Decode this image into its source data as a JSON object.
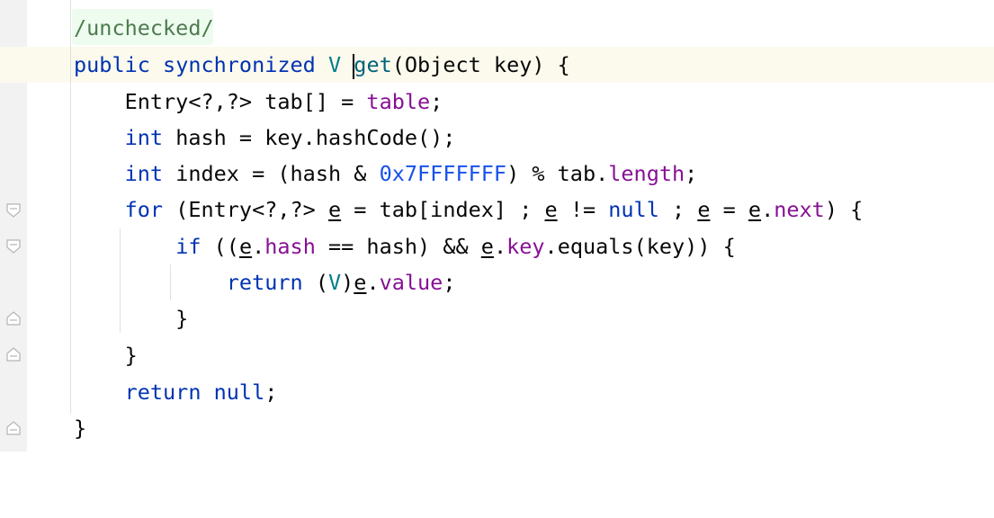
{
  "editor": {
    "colors": {
      "keyword": "#0033b3",
      "type_param": "#007e8a",
      "method": "#00627a",
      "field": "#871094",
      "number": "#1750eb",
      "current_line_bg": "#fcfaed",
      "annotation_bg": "#edfcef",
      "gutter_strip": "#f2f2f2"
    },
    "icons": {
      "intention": "lightbulb-icon",
      "fold_open": "fold-open-icon",
      "fold_close": "fold-close-icon"
    },
    "code": {
      "line0": [
        "/unchecked/"
      ],
      "line1": [
        "public",
        " ",
        "synchronized",
        " ",
        "V",
        " ",
        "get",
        "(Object key) {"
      ],
      "line2": [
        "    Entry<?,?> tab[] = ",
        "table",
        ";"
      ],
      "line3": [
        "    ",
        "int",
        " hash = key.hashCode();"
      ],
      "line4": [
        "    ",
        "int",
        " index = (hash & ",
        "0x7FFFFFFF",
        ") % tab.",
        "length",
        ";"
      ],
      "line5": [
        "    ",
        "for",
        " (Entry<?,?> ",
        "e",
        " = tab[index] ; ",
        "e",
        " != ",
        "null",
        " ; ",
        "e",
        " = ",
        "e",
        ".",
        "next",
        ") {"
      ],
      "line6": [
        "        ",
        "if",
        " ((",
        "e",
        ".",
        "hash",
        " == hash) && ",
        "e",
        ".",
        "key",
        ".equals(key)) {"
      ],
      "line7": [
        "            ",
        "return",
        " (",
        "V",
        ")",
        "e",
        ".",
        "value",
        ";"
      ],
      "line8": [
        "        }"
      ],
      "line9": [
        "    }"
      ],
      "line10": [
        "    ",
        "return",
        " ",
        "null",
        ";"
      ],
      "line11": [
        "}"
      ]
    }
  }
}
